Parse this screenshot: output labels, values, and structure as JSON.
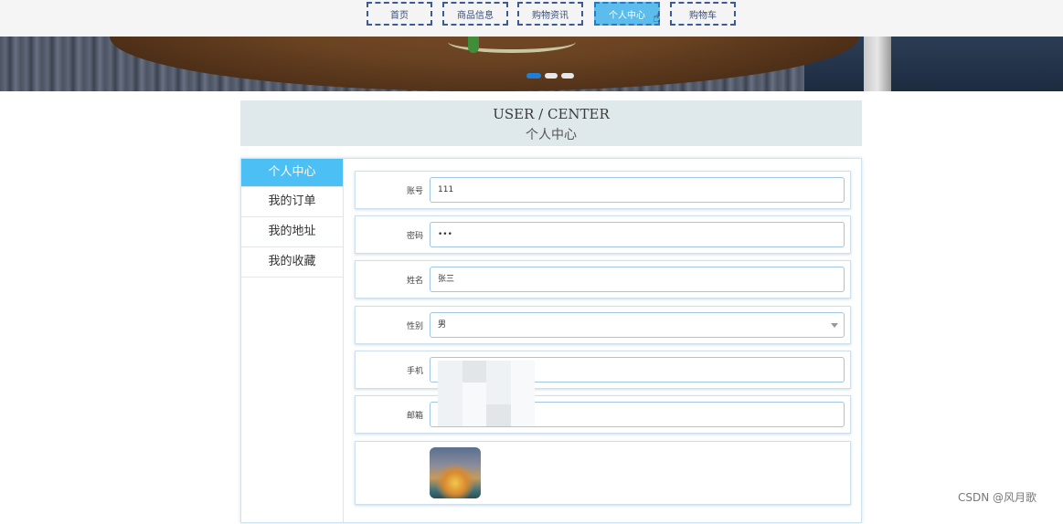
{
  "nav": {
    "items": [
      "首页",
      "商品信息",
      "购物资讯",
      "个人中心",
      "购物车"
    ],
    "active_index": 3
  },
  "banner": {
    "slides": 3,
    "active_slide": 0
  },
  "title": {
    "en": "USER / CENTER",
    "cn": "个人中心"
  },
  "sidebar": {
    "items": [
      "个人中心",
      "我的订单",
      "我的地址",
      "我的收藏"
    ],
    "active_index": 0
  },
  "form": {
    "account": {
      "label": "账号",
      "value": "111"
    },
    "password": {
      "label": "密码",
      "value": "•••"
    },
    "name": {
      "label": "姓名",
      "value": "张三"
    },
    "gender": {
      "label": "性别",
      "value": "男"
    },
    "phone": {
      "label": "手机",
      "value": ""
    },
    "email": {
      "label": "邮箱",
      "value": ""
    }
  },
  "colors": {
    "accent": "#4cc0f4",
    "nav_active": "#5cbcec",
    "nav_border": "#3a5a99"
  },
  "watermark": "CSDN @风月歌"
}
